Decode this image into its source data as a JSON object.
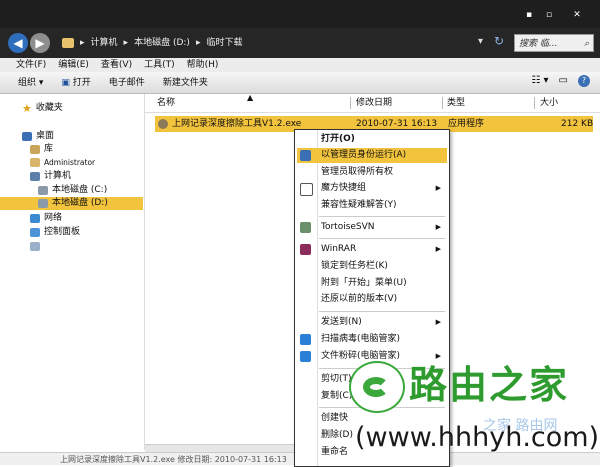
{
  "titlebar": {
    "minimize": "▪",
    "maximize": "▫",
    "close": "✕"
  },
  "address": {
    "crumbs": [
      "计算机",
      "本地磁盘 (D:)",
      "临时下载"
    ],
    "separator": "▸",
    "search_placeholder": "搜索 临..."
  },
  "menu": [
    "文件(F)",
    "编辑(E)",
    "查看(V)",
    "工具(T)",
    "帮助(H)"
  ],
  "toolbar": {
    "organize": "组织 ▾",
    "open": "打开",
    "email": "电子邮件",
    "new_folder": "新建文件夹"
  },
  "sidebar": {
    "favorites": "收藏夹",
    "desktop": "桌面",
    "libraries": "库",
    "user": "Administrator",
    "computer": "计算机",
    "drive_c": "本地磁盘 (C:)",
    "drive_d": "本地磁盘 (D:)",
    "network": "网络",
    "control_panel": "控制面板"
  },
  "columns": {
    "name": "名称",
    "date": "修改日期",
    "type": "类型",
    "size": "大小"
  },
  "file": {
    "name": "上网记录深度擦除工具V1.2.exe",
    "date": "2010-07-31 16:13",
    "type": "应用程序",
    "size": "212 KB"
  },
  "context_menu": {
    "open": "打开(O)",
    "run_as_admin": "以管理员身份运行(A)",
    "take_ownership": "管理员取得所有权",
    "magic_group": "魔方快捷组",
    "compat": "兼容性疑难解答(Y)",
    "tortoise": "TortoiseSVN",
    "winrar": "WinRAR",
    "pin_taskbar": "锁定到任务栏(K)",
    "pin_start": "附到「开始」菜单(U)",
    "restore": "还原以前的版本(V)",
    "send_to": "发送到(N)",
    "scan": "扫描病毒(电脑管家)",
    "shred": "文件粉碎(电脑管家)",
    "cut": "剪切(T)",
    "copy": "复制(C)",
    "shortcut": "创建快",
    "delete": "删除(D)",
    "rename": "重命名"
  },
  "status": {
    "text": "上网记录深度擦除工具V1.2.exe  修改日期: 2010-07-31 16:13"
  },
  "watermark": {
    "brand": "路由之家",
    "url": "(www.hhhyh.com)",
    "ghost": "之家 路由网"
  },
  "colors": {
    "highlight": "#f2c33d",
    "brand_green": "#2e9b2e",
    "titlebar": "#1e1e1e"
  }
}
